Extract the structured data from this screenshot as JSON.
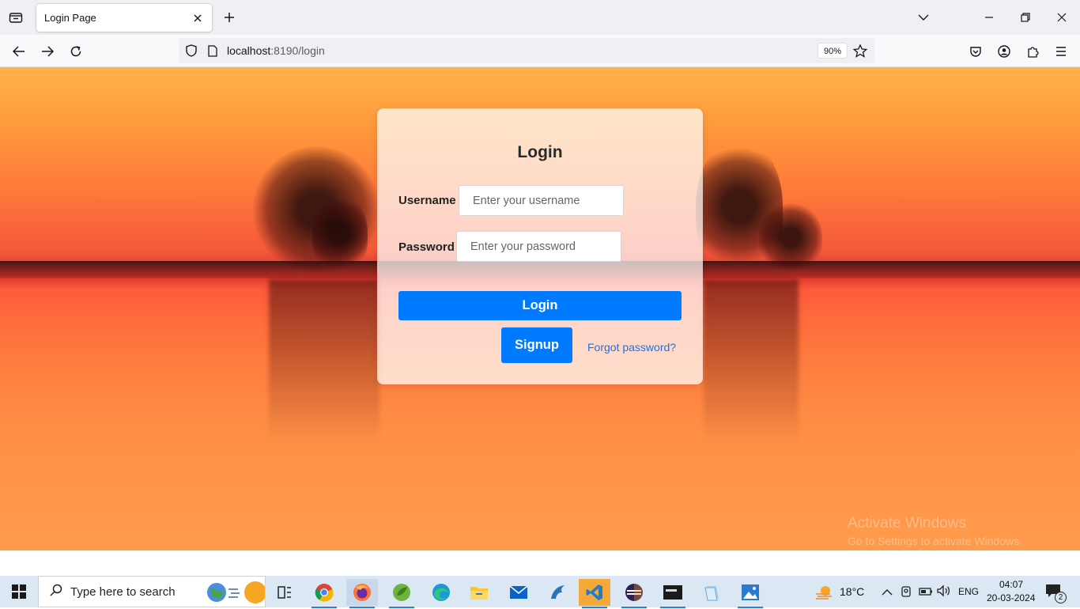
{
  "browser": {
    "tab_title": "Login Page",
    "url_host": "localhost",
    "url_rest": ":8190/login",
    "zoom": "90%"
  },
  "login": {
    "title": "Login",
    "username_label": "Username",
    "username_placeholder": "Enter your username",
    "password_label": "Password",
    "password_placeholder": "Enter your password",
    "login_button": "Login",
    "signup_button": "Signup",
    "forgot_link": "Forgot password?"
  },
  "watermark": {
    "line1": "Activate Windows",
    "line2": "Go to Settings to activate Windows."
  },
  "taskbar": {
    "search_placeholder": "Type here to search",
    "weather_temp": "18°C",
    "language": "ENG",
    "time": "04:07",
    "date": "20-03-2024",
    "notifications": "2"
  },
  "colors": {
    "primary_button": "#007bff",
    "link": "#1a73e8"
  }
}
